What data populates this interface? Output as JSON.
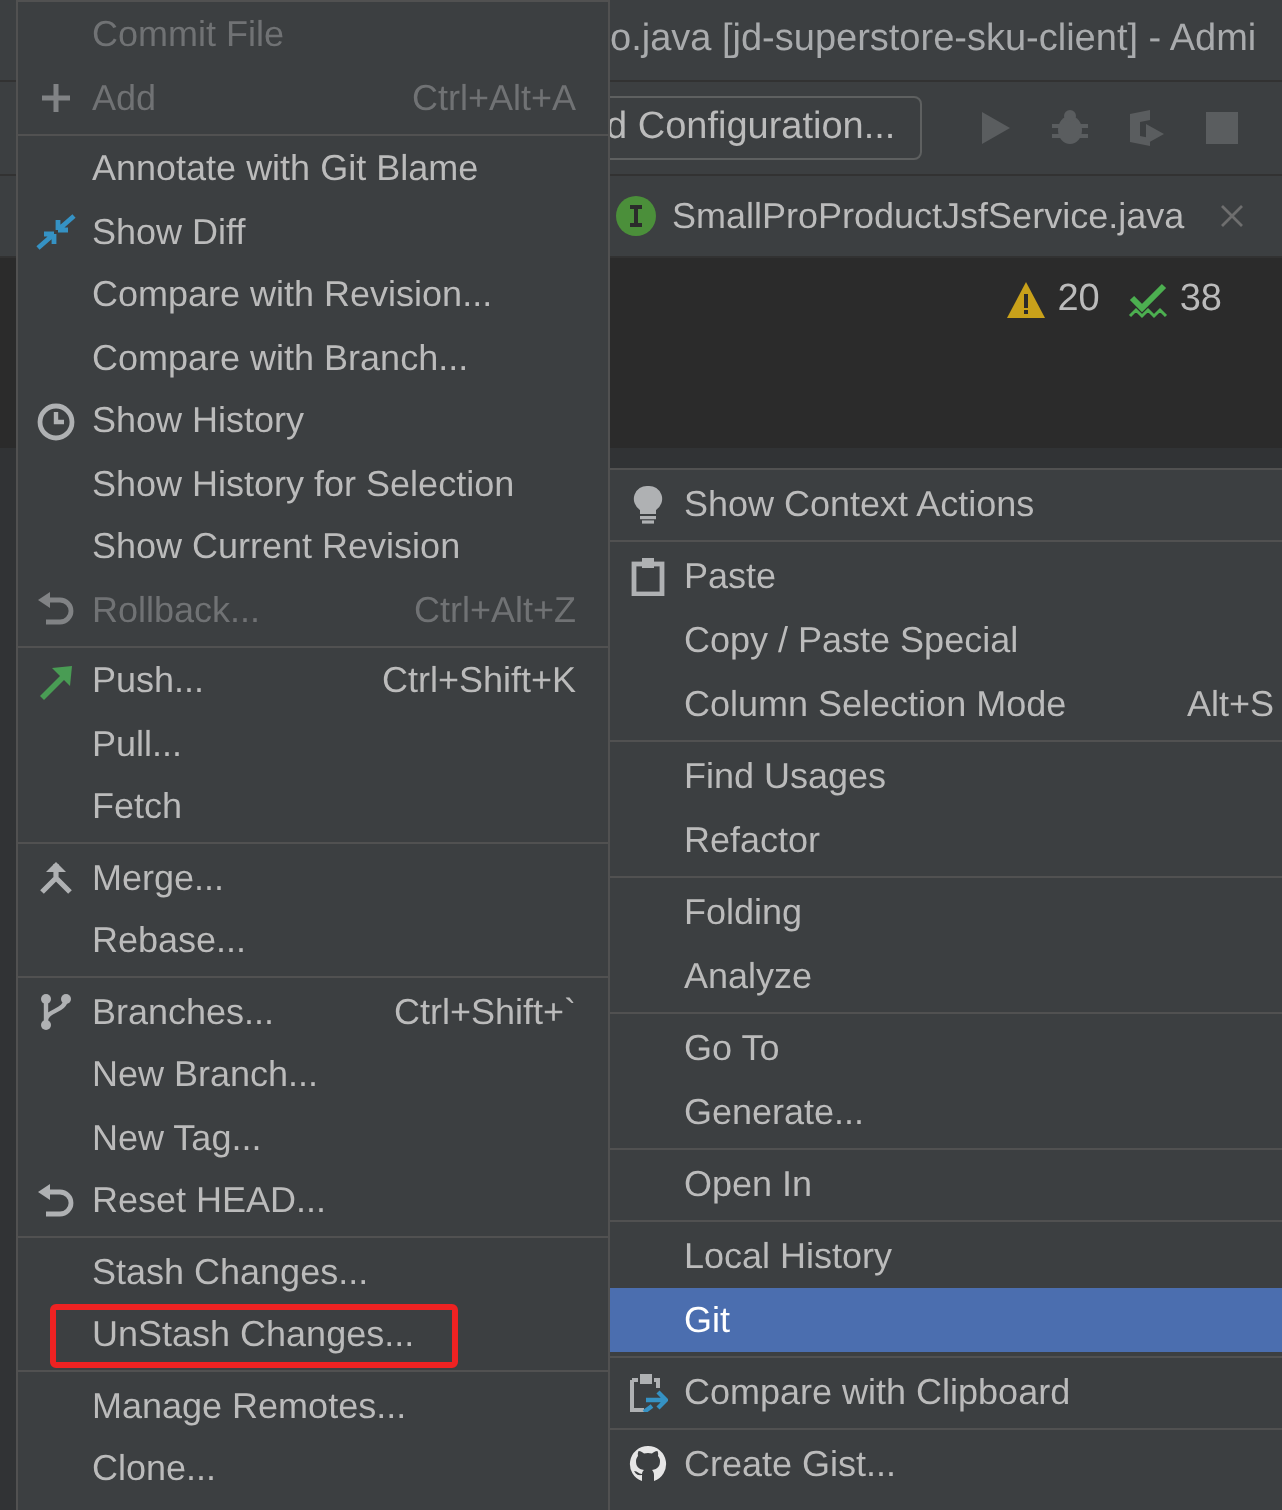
{
  "title_bar": {
    "title": "o.java [jd-superstore-sku-client] - Admi"
  },
  "toolbar": {
    "configuration": "d Configuration..."
  },
  "editor_tab": {
    "label": "SmallProProductJsfService.java"
  },
  "inspections": {
    "warnings": "20",
    "weak_warnings": "38"
  },
  "left_menu": {
    "groups": [
      {
        "items": [
          {
            "label": "Commit File",
            "disabled": true,
            "outlined": false
          },
          {
            "label": "Add",
            "shortcut": "Ctrl+Alt+A",
            "disabled": true,
            "outlined": false
          }
        ]
      },
      {
        "items": [
          {
            "label": "Annotate with Git Blame",
            "disabled": false,
            "outlined": false
          },
          {
            "label": "Show Diff",
            "disabled": false,
            "outlined": false
          },
          {
            "label": "Compare with Revision...",
            "disabled": false,
            "outlined": false
          },
          {
            "label": "Compare with Branch...",
            "disabled": false,
            "outlined": false
          },
          {
            "label": "Show History",
            "disabled": false,
            "outlined": false
          },
          {
            "label": "Show History for Selection",
            "disabled": false,
            "outlined": false
          },
          {
            "label": "Show Current Revision",
            "disabled": false,
            "outlined": false
          },
          {
            "label": "Rollback...",
            "shortcut": "Ctrl+Alt+Z",
            "disabled": true,
            "outlined": false
          }
        ]
      },
      {
        "items": [
          {
            "label": "Push...",
            "shortcut": "Ctrl+Shift+K",
            "disabled": false,
            "outlined": false
          },
          {
            "label": "Pull...",
            "disabled": false,
            "outlined": false
          },
          {
            "label": "Fetch",
            "disabled": false,
            "outlined": false
          }
        ]
      },
      {
        "items": [
          {
            "label": "Merge...",
            "disabled": false,
            "outlined": false
          },
          {
            "label": "Rebase...",
            "disabled": false,
            "outlined": false
          }
        ]
      },
      {
        "items": [
          {
            "label": "Branches...",
            "shortcut": "Ctrl+Shift+`",
            "disabled": false,
            "outlined": false
          },
          {
            "label": "New Branch...",
            "disabled": false,
            "outlined": false
          },
          {
            "label": "New Tag...",
            "disabled": false,
            "outlined": false
          },
          {
            "label": "Reset HEAD...",
            "disabled": false,
            "outlined": false
          }
        ]
      },
      {
        "items": [
          {
            "label": "Stash Changes...",
            "disabled": false,
            "outlined": false
          },
          {
            "label": "UnStash Changes...",
            "disabled": false,
            "outlined": true
          }
        ]
      },
      {
        "items": [
          {
            "label": "Manage Remotes...",
            "disabled": false,
            "outlined": false
          },
          {
            "label": "Clone...",
            "disabled": false,
            "outlined": false
          }
        ]
      }
    ]
  },
  "right_menu": {
    "groups": [
      {
        "items": [
          {
            "label": "Show Context Actions",
            "selected": false
          }
        ]
      },
      {
        "items": [
          {
            "label": "Paste",
            "selected": false
          },
          {
            "label": "Copy / Paste Special",
            "selected": false
          },
          {
            "label": "Column Selection Mode",
            "shortcut": "Alt+S",
            "selected": false
          }
        ]
      },
      {
        "items": [
          {
            "label": "Find Usages",
            "selected": false
          },
          {
            "label": "Refactor",
            "selected": false
          }
        ]
      },
      {
        "items": [
          {
            "label": "Folding",
            "selected": false
          },
          {
            "label": "Analyze",
            "selected": false
          }
        ]
      },
      {
        "items": [
          {
            "label": "Go To",
            "selected": false
          },
          {
            "label": "Generate...",
            "selected": false
          }
        ]
      },
      {
        "items": [
          {
            "label": "Open In",
            "selected": false
          }
        ]
      },
      {
        "items": [
          {
            "label": "Local History",
            "selected": false
          },
          {
            "label": "Git",
            "selected": true
          }
        ]
      },
      {
        "items": [
          {
            "label": "Compare with Clipboard",
            "selected": false
          }
        ]
      },
      {
        "items": [
          {
            "label": "Create Gist...",
            "selected": false
          }
        ]
      }
    ]
  }
}
